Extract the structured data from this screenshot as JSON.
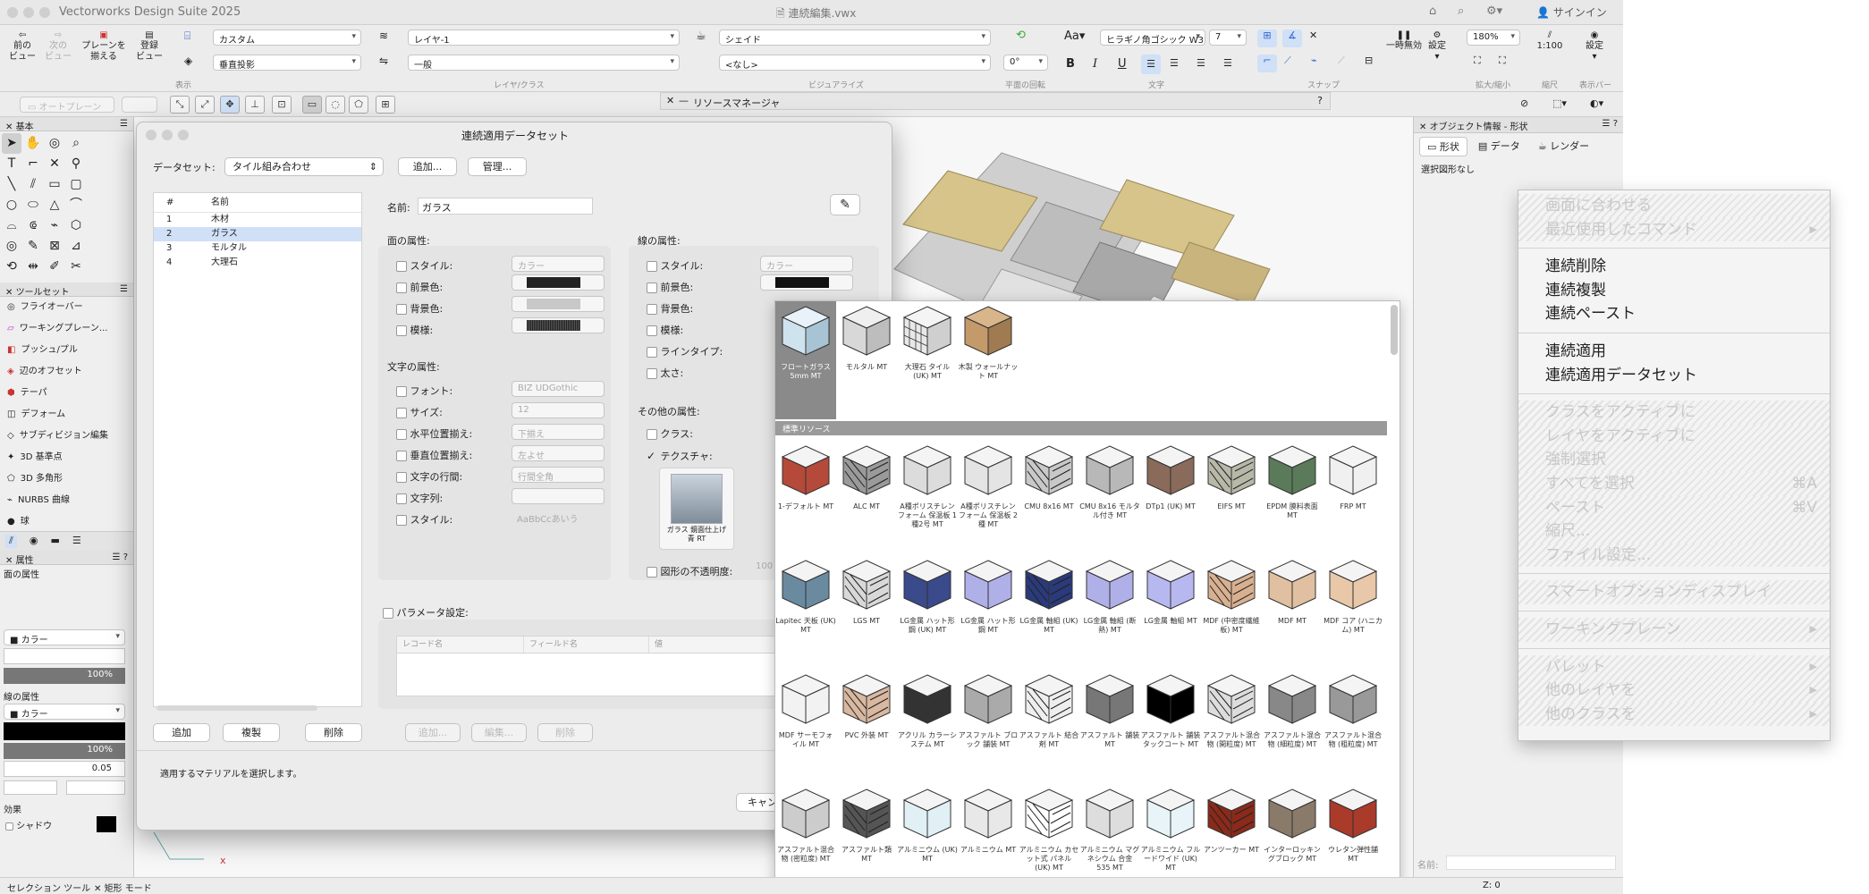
{
  "app": {
    "name": "Vectorworks Design Suite 2025",
    "doc_title": "連続編集.vwx",
    "signin": "サインイン"
  },
  "toolbar": {
    "prev_view": "前の\nビュー",
    "next_view": "次の\nビュー",
    "plane_align": "プレーンを\n揃える",
    "reg_view": "登録\nビュー",
    "class_dd": "カスタム",
    "layer_dd": "レイヤ-1",
    "render_dd": "シェイド",
    "proj_dd": "垂直投影",
    "class2_dd": "一般",
    "none_dd": "<なし>",
    "font_dd": "ヒラギノ角ゴシック W3",
    "size_dd": "7",
    "zoom_dd": "180%",
    "scale": "1:100",
    "rotation": "0°",
    "pause": "一時無効",
    "settings": "設定",
    "settings2": "設定",
    "group_view": "表示",
    "group_layer": "レイヤ/クラス",
    "group_vis": "ビジュアライズ",
    "group_rot": "平面の回転",
    "group_text": "文字",
    "group_snap": "スナップ",
    "group_zoom": "拡大/縮小",
    "group_scale": "縮尺",
    "group_bar": "表示バー",
    "bold": "B",
    "italic": "I",
    "underline": "U",
    "auto_plane": "オートプレーン"
  },
  "resource_manager": {
    "title": "リソースマネージャ",
    "help": "?"
  },
  "left_palette": {
    "basic_title": "基本",
    "toolset_title": "ツールセット",
    "attr_title": "属性",
    "toolset_items": [
      "フライオーバー",
      "ワーキングプレーン...",
      "プッシュ/プル",
      "辺のオフセット",
      "テーパ",
      "デフォーム",
      "サブディビジョン編集",
      "3D 基準点",
      "3D 多角形",
      "NURBS 曲線",
      "球",
      "半球"
    ],
    "fill_label": "面の属性",
    "fill_type": "カラー",
    "fill_opacity": "100%",
    "line_label": "線の属性",
    "line_type": "カラー",
    "line_opacity": "100%",
    "line_weight": "0.05",
    "effect_label": "効果",
    "shadow_label": "シャドウ"
  },
  "status": {
    "tool": "セレクション ツール",
    "mode": "矩形 モード",
    "z": "Z: 0"
  },
  "object_info": {
    "title": "オブジェクト情報 - 形状",
    "tabs": [
      "形状",
      "データ",
      "レンダー"
    ],
    "no_selection": "選択図形なし",
    "name_label": "名前:"
  },
  "dialog": {
    "title": "連続適用データセット",
    "dataset_label": "データセット:",
    "dataset_value": "タイル組み合わせ",
    "add_btn": "追加...",
    "manage_btn": "管理...",
    "list_headers": [
      "#",
      "名前"
    ],
    "list_rows": [
      {
        "num": "1",
        "name": "木材"
      },
      {
        "num": "2",
        "name": "ガラス"
      },
      {
        "num": "3",
        "name": "モルタル"
      },
      {
        "num": "4",
        "name": "大理石"
      }
    ],
    "selected_index": 1,
    "name_label": "名前:",
    "name_value": "ガラス",
    "fill_section": "面の属性:",
    "line_section": "線の属性:",
    "fill_rows": [
      {
        "label": "スタイル:",
        "value": "カラー"
      },
      {
        "label": "前景色:"
      },
      {
        "label": "背景色:"
      },
      {
        "label": "模様:"
      }
    ],
    "line_rows": [
      {
        "label": "スタイル:",
        "value": "カラー"
      },
      {
        "label": "前景色:"
      },
      {
        "label": "背景色:"
      },
      {
        "label": "模様:"
      },
      {
        "label": "ラインタイプ:"
      },
      {
        "label": "太さ:"
      }
    ],
    "text_section": "文字の属性:",
    "text_rows": [
      {
        "label": "フォント:",
        "value": "BIZ UDGothic"
      },
      {
        "label": "サイズ:",
        "value": "12"
      },
      {
        "label": "水平位置揃え:",
        "value": "下揃え"
      },
      {
        "label": "垂直位置揃え:",
        "value": "左よせ"
      },
      {
        "label": "文字の行間:",
        "value": "行間全角"
      },
      {
        "label": "文字列:",
        "value": ""
      },
      {
        "label": "スタイル:",
        "value": "AaBbCcあいう"
      }
    ],
    "other_section": "その他の属性:",
    "class_label": "クラス:",
    "texture_label": "テクスチャ:",
    "texture_name": "ガラス 鏡面仕上げ 青 RT",
    "opacity_label": "図形の不透明度:",
    "opacity_value": "100",
    "param_label": "パラメータ設定:",
    "param_headers": [
      "レコード名",
      "フィールド名",
      "値"
    ],
    "param_btns": [
      "追加...",
      "編集...",
      "削除"
    ],
    "bottom_btns": [
      "追加",
      "複製",
      "削除"
    ],
    "hint": "適用するマテリアルを選択します。",
    "cancel": "キャン"
  },
  "picker": {
    "top_items": [
      "フロートガラス 5mm MT",
      "モルタル MT",
      "大理石 タイル (UK) MT",
      "木製 ウォールナット MT"
    ],
    "section": "標準リソース",
    "rows": [
      [
        "1-デフォルト MT",
        "ALC MT",
        "A種ポリスチレンフォーム 保温板 1種2号 MT",
        "A種ポリスチレンフォーム 保温板 2種 MT",
        "CMU 8x16 MT",
        "CMU 8x16 モルタル付き MT",
        "DTp1 (UK) MT",
        "EIFS MT",
        "EPDM 膜料表面 MT",
        "FRP MT"
      ],
      [
        "Lapitec 天板 (UK) MT",
        "LGS MT",
        "LG金属 ハット形鋼 (UK) MT",
        "LG金属 ハット形鋼 MT",
        "LG金属 軸組 (UK) MT",
        "LG金属 軸組 (断熱) MT",
        "LG金属 軸組 MT",
        "MDF (中密度繊維板) MT",
        "MDF MT",
        "MDF コア (ハニカム) MT"
      ],
      [
        "MDF サーモフォイル MT",
        "PVC 外装 MT",
        "アクリル カラーシステム MT",
        "アスファルト ブロック 舗装 MT",
        "アスファルト 結合剤 MT",
        "アスファルト 舗装 MT",
        "アスファルト 舗装 タックコート MT",
        "アスファルト混合物 (開粒度) MT",
        "アスファルト混合物 (細粒度) MT",
        "アスファルト混合物 (粗粒度) MT"
      ],
      [
        "アスファルト混合物 (密粒度) MT",
        "アスファルト類 MT",
        "アルミニウム (UK) MT",
        "アルミニウム MT",
        "アルミニウム カセット式 パネル (UK) MT",
        "アルミニウム マグネシウム 合金 535 MT",
        "アルミニウム フルードワイド (UK) MT",
        "アンツーカー MT",
        "インターロッキングブロック MT",
        "ウレタン弾性舗 MT"
      ]
    ]
  },
  "context_menu": {
    "items": [
      {
        "label": "画面に合わせる",
        "disabled": true
      },
      {
        "label": "最近使用したコマンド",
        "disabled": true,
        "submenu": true
      },
      {
        "sep": true
      },
      {
        "label": "連続削除",
        "disabled": false
      },
      {
        "label": "連続複製",
        "disabled": false
      },
      {
        "label": "連続ペースト",
        "disabled": false
      },
      {
        "sep": true
      },
      {
        "label": "連続適用",
        "disabled": false
      },
      {
        "label": "連続適用データセット",
        "disabled": false
      },
      {
        "sep": true
      },
      {
        "label": "クラスをアクティブに",
        "disabled": true
      },
      {
        "label": "レイヤをアクティブに",
        "disabled": true
      },
      {
        "label": "強制選択",
        "disabled": true
      },
      {
        "label": "すべてを選択",
        "disabled": true,
        "shortcut": "⌘A"
      },
      {
        "label": "ペースト",
        "disabled": true,
        "shortcut": "⌘V"
      },
      {
        "label": "縮尺...",
        "disabled": true
      },
      {
        "label": "ファイル設定...",
        "disabled": true
      },
      {
        "sep": true
      },
      {
        "label": "スマートオプションディスプレイ",
        "disabled": true
      },
      {
        "sep": true
      },
      {
        "label": "ワーキングプレーン",
        "disabled": true,
        "submenu": true
      },
      {
        "sep": true
      },
      {
        "label": "パレット",
        "disabled": true,
        "submenu": true
      },
      {
        "label": "他のレイヤを",
        "disabled": true,
        "submenu": true
      },
      {
        "label": "他のクラスを",
        "disabled": true,
        "submenu": true
      }
    ]
  }
}
